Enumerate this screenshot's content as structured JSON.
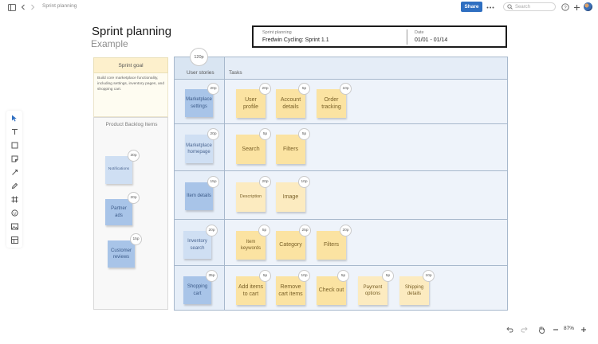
{
  "topbar": {
    "breadcrumb": "Sprint planning",
    "share_label": "Share",
    "search_placeholder": "Search",
    "icons": [
      "sidebar-icon",
      "back-icon",
      "forward-icon",
      "more-icon",
      "help-icon",
      "add-icon",
      "avatar"
    ]
  },
  "page": {
    "title": "Sprint planning",
    "subtitle": "Example"
  },
  "info": {
    "project_label": "Sprint planning",
    "project_value": "Fredwin Cycling: Sprint 1.1",
    "date_label": "Date",
    "date_value": "01/01 - 01/14"
  },
  "goal": {
    "title": "Sprint goal",
    "text": "Build core marketplace functionality, including settings, inventory pages, and shopping cart."
  },
  "backlog": {
    "title": "Product Backlog Items",
    "items": [
      {
        "label": "Notifications",
        "points": "30p"
      },
      {
        "label": "Partner ads",
        "points": "20p"
      },
      {
        "label": "Customer reviews",
        "points": "15p"
      }
    ]
  },
  "board": {
    "total_points": "120p",
    "stories_header": "User stories",
    "tasks_header": "Tasks",
    "rows": [
      {
        "story": {
          "label": "Marketplace settings",
          "points": "20p"
        },
        "tasks": [
          {
            "label": "User profile",
            "points": "20p"
          },
          {
            "label": "Account details",
            "points": "5p"
          },
          {
            "label": "Order tracking",
            "points": "10p"
          }
        ]
      },
      {
        "story": {
          "label": "Marketplace homepage",
          "points": "20p"
        },
        "tasks": [
          {
            "label": "Search",
            "points": "5p"
          },
          {
            "label": "Filters",
            "points": "5p"
          }
        ]
      },
      {
        "story": {
          "label": "Item details",
          "points": "15p"
        },
        "tasks": [
          {
            "label": "Description",
            "points": "20p"
          },
          {
            "label": "Image",
            "points": "10p"
          }
        ]
      },
      {
        "story": {
          "label": "Inventory search",
          "points": "20p"
        },
        "tasks": [
          {
            "label": "Item keywords",
            "points": "5p"
          },
          {
            "label": "Category",
            "points": "25p"
          },
          {
            "label": "Filters",
            "points": "20p"
          }
        ]
      },
      {
        "story": {
          "label": "Shopping cart",
          "points": "35p"
        },
        "tasks": [
          {
            "label": "Add items to cart",
            "points": "5p"
          },
          {
            "label": "Remove cart items",
            "points": "10p"
          },
          {
            "label": "Check out",
            "points": "5p"
          },
          {
            "label": "Payment options",
            "points": "5p"
          },
          {
            "label": "Shipping details",
            "points": "10p"
          }
        ]
      }
    ]
  },
  "tools": [
    "select-tool-icon",
    "text-tool-icon",
    "shape-tool-icon",
    "sticky-tool-icon",
    "line-tool-icon",
    "pen-tool-icon",
    "frame-tool-icon",
    "sticker-tool-icon",
    "image-tool-icon",
    "template-tool-icon"
  ],
  "zoom": {
    "level": "87%"
  },
  "colors": {
    "accent": "#2f6fc1",
    "story": "#a8c4e8",
    "task": "#fbe3a2",
    "board": "#eef3fa"
  }
}
